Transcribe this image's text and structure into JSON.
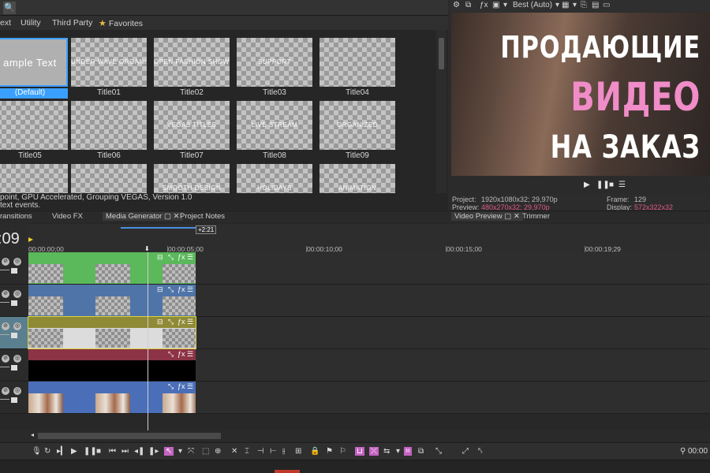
{
  "media_generator": {
    "tabs": [
      "ext",
      "Utility",
      "Third Party",
      "Favorites"
    ],
    "thumbnails": [
      {
        "caption": "(Default)",
        "text": "ample Text",
        "selected": true
      },
      {
        "caption": "Title01",
        "text": "UNDER WAVE ORGANIZATION",
        "selected": false
      },
      {
        "caption": "Title02",
        "text": "OPEN FASHION SHOW TODAY",
        "selected": false
      },
      {
        "caption": "Title03",
        "text": "SUPPORT",
        "selected": false
      },
      {
        "caption": "Title04",
        "text": "",
        "selected": false
      },
      {
        "caption": "Title05",
        "text": "",
        "selected": false
      },
      {
        "caption": "Title06",
        "text": "",
        "selected": false
      },
      {
        "caption": "Title07",
        "text": "VEGAS TITLES",
        "selected": false
      },
      {
        "caption": "Title08",
        "text": "LIVE STREAM",
        "selected": false
      },
      {
        "caption": "Title09",
        "text": "ORGANIZED",
        "selected": false
      },
      {
        "caption": "",
        "text": "",
        "selected": false
      },
      {
        "caption": "",
        "text": "",
        "selected": false
      },
      {
        "caption": "",
        "text": "SMOOTH DESIGN",
        "selected": false
      },
      {
        "caption": "",
        "text": "HOLIDAYS",
        "selected": false
      },
      {
        "caption": "",
        "text": "ANIMATION",
        "selected": false
      }
    ],
    "status_line1": "point, GPU Accelerated, Grouping VEGAS, Version 1.0",
    "status_line2": "text events."
  },
  "preview": {
    "quality": "Best (Auto)",
    "video_lines": [
      "ПРОДАЮЩИЕ",
      "ВИДЕО",
      "НА ЗАКАЗ"
    ],
    "line_colors": [
      "#ffffff",
      "#f08cc8",
      "#ffffff"
    ],
    "project_label": "Project:",
    "project_value": "1920x1080x32; 29,970p",
    "preview_label": "Preview:",
    "preview_value": "480x270x32; 29,970p",
    "frame_label": "Frame:",
    "frame_value": "129",
    "display_label": "Display:",
    "display_value": "572x322x32"
  },
  "dock_tabs": [
    "ransitions",
    "Video FX",
    "Media Generator",
    "Project Notes",
    "Video Preview",
    "Trimmer"
  ],
  "timeline": {
    "time": ":09",
    "loop_badge": "+2:21",
    "ruler": [
      "00:00:00;00",
      "00:00:05;00",
      "00:00:10;00",
      "00:00:15;00",
      "00:00:19;29"
    ],
    "tracks": [
      {
        "color": "#5bb85b",
        "body": "#5bb85b"
      },
      {
        "color": "#4f74a8",
        "body": "#4f74a8"
      },
      {
        "color": "#8f8a36",
        "body": "#dcdcdc"
      },
      {
        "color": "#8c3346",
        "body": "#000000"
      },
      {
        "color": "#4a6fb8",
        "body": "#4a6fb8"
      }
    ]
  },
  "transport": {
    "timecode": "00:00"
  }
}
